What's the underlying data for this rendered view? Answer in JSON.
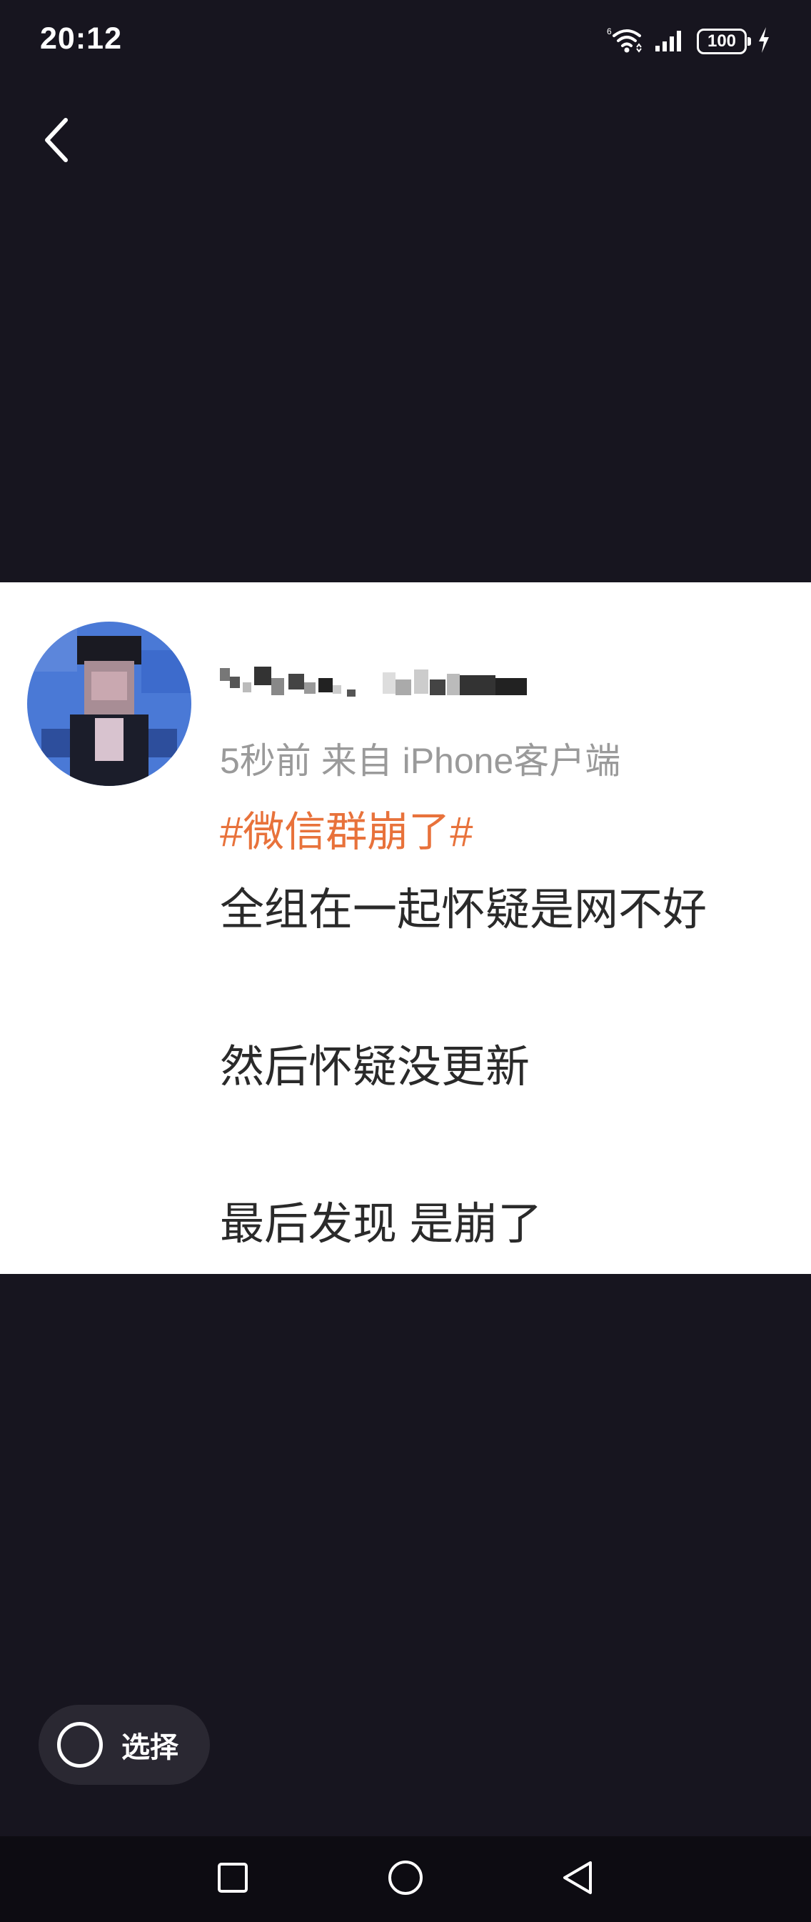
{
  "status_bar": {
    "time": "20:12",
    "battery": "100",
    "icons": [
      "wifi-icon",
      "signal-icon",
      "battery-icon",
      "charging-icon"
    ]
  },
  "header": {
    "back_icon": "chevron-left-icon"
  },
  "post": {
    "username": "",
    "meta": "5秒前  来自 iPhone客户端",
    "hashtag": "#微信群崩了#",
    "lines": [
      "全组在一起怀疑是网不好",
      "然后怀疑没更新",
      "最后发现 是崩了"
    ]
  },
  "select": {
    "label": "选择"
  },
  "nav": {
    "icons": [
      "recents-icon",
      "home-icon",
      "back-triangle-icon"
    ]
  },
  "colors": {
    "background": "#17151f",
    "hashtag": "#e8723b",
    "meta": "#9a9a9a"
  }
}
